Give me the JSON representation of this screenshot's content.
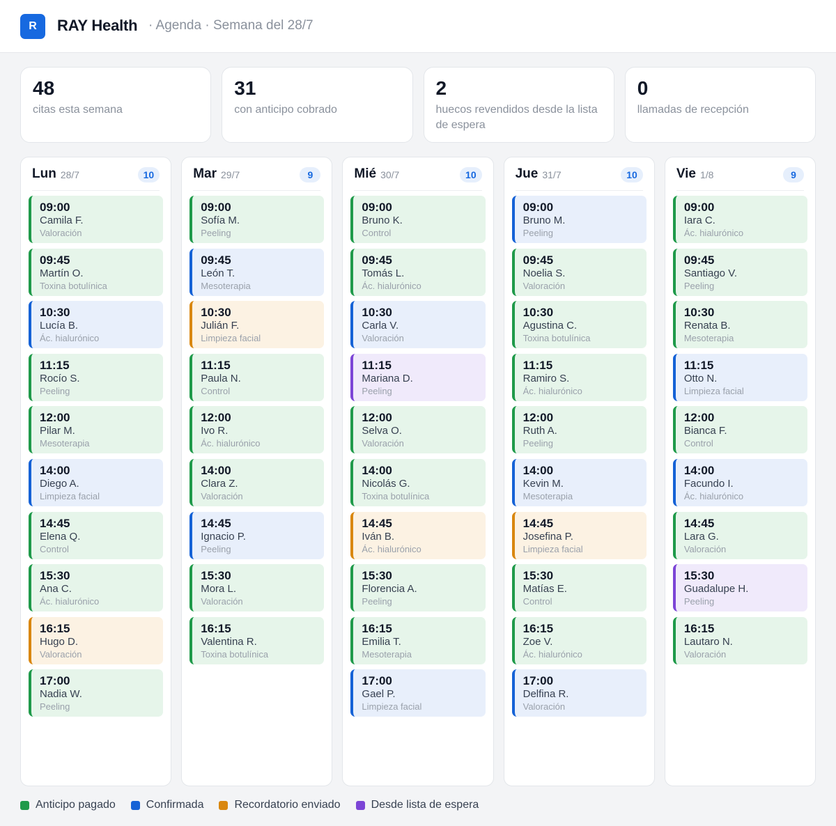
{
  "header": {
    "logo_letter": "R",
    "app_name": "RAY Health",
    "breadcrumb": "· Agenda · Semana del 28/7"
  },
  "stats": [
    {
      "value": "48",
      "label": "citas esta semana"
    },
    {
      "value": "31",
      "label": "con anticipo cobrado"
    },
    {
      "value": "2",
      "label": "huecos revendidos desde la lista de espera"
    },
    {
      "value": "0",
      "label": "llamadas de recepción"
    }
  ],
  "days": [
    {
      "name": "Lun",
      "date": "28/7",
      "count": "10",
      "appointments": [
        {
          "time": "09:00",
          "patient": "Camila F.",
          "service": "Valoración",
          "status": "paid"
        },
        {
          "time": "09:45",
          "patient": "Martín O.",
          "service": "Toxina botulínica",
          "status": "paid"
        },
        {
          "time": "10:30",
          "patient": "Lucía B.",
          "service": "Ác. hialurónico",
          "status": "confirmed"
        },
        {
          "time": "11:15",
          "patient": "Rocío S.",
          "service": "Peeling",
          "status": "paid"
        },
        {
          "time": "12:00",
          "patient": "Pilar M.",
          "service": "Mesoterapia",
          "status": "paid"
        },
        {
          "time": "14:00",
          "patient": "Diego A.",
          "service": "Limpieza facial",
          "status": "confirmed"
        },
        {
          "time": "14:45",
          "patient": "Elena Q.",
          "service": "Control",
          "status": "paid"
        },
        {
          "time": "15:30",
          "patient": "Ana C.",
          "service": "Ác. hialurónico",
          "status": "paid"
        },
        {
          "time": "16:15",
          "patient": "Hugo D.",
          "service": "Valoración",
          "status": "reminder"
        },
        {
          "time": "17:00",
          "patient": "Nadia W.",
          "service": "Peeling",
          "status": "paid"
        }
      ]
    },
    {
      "name": "Mar",
      "date": "29/7",
      "count": "9",
      "appointments": [
        {
          "time": "09:00",
          "patient": "Sofía M.",
          "service": "Peeling",
          "status": "paid"
        },
        {
          "time": "09:45",
          "patient": "León T.",
          "service": "Mesoterapia",
          "status": "confirmed"
        },
        {
          "time": "10:30",
          "patient": "Julián F.",
          "service": "Limpieza facial",
          "status": "reminder"
        },
        {
          "time": "11:15",
          "patient": "Paula N.",
          "service": "Control",
          "status": "paid"
        },
        {
          "time": "12:00",
          "patient": "Ivo R.",
          "service": "Ác. hialurónico",
          "status": "paid"
        },
        {
          "time": "14:00",
          "patient": "Clara Z.",
          "service": "Valoración",
          "status": "paid"
        },
        {
          "time": "14:45",
          "patient": "Ignacio P.",
          "service": "Peeling",
          "status": "confirmed"
        },
        {
          "time": "15:30",
          "patient": "Mora L.",
          "service": "Valoración",
          "status": "paid"
        },
        {
          "time": "16:15",
          "patient": "Valentina R.",
          "service": "Toxina botulínica",
          "status": "paid"
        }
      ]
    },
    {
      "name": "Mié",
      "date": "30/7",
      "count": "10",
      "appointments": [
        {
          "time": "09:00",
          "patient": "Bruno K.",
          "service": "Control",
          "status": "paid"
        },
        {
          "time": "09:45",
          "patient": "Tomás L.",
          "service": "Ác. hialurónico",
          "status": "paid"
        },
        {
          "time": "10:30",
          "patient": "Carla V.",
          "service": "Valoración",
          "status": "confirmed"
        },
        {
          "time": "11:15",
          "patient": "Mariana D.",
          "service": "Peeling",
          "status": "waitlist"
        },
        {
          "time": "12:00",
          "patient": "Selva O.",
          "service": "Valoración",
          "status": "paid"
        },
        {
          "time": "14:00",
          "patient": "Nicolás G.",
          "service": "Toxina botulínica",
          "status": "paid"
        },
        {
          "time": "14:45",
          "patient": "Iván B.",
          "service": "Ác. hialurónico",
          "status": "reminder"
        },
        {
          "time": "15:30",
          "patient": "Florencia A.",
          "service": "Peeling",
          "status": "paid"
        },
        {
          "time": "16:15",
          "patient": "Emilia T.",
          "service": "Mesoterapia",
          "status": "paid"
        },
        {
          "time": "17:00",
          "patient": "Gael P.",
          "service": "Limpieza facial",
          "status": "confirmed"
        }
      ]
    },
    {
      "name": "Jue",
      "date": "31/7",
      "count": "10",
      "appointments": [
        {
          "time": "09:00",
          "patient": "Bruno M.",
          "service": "Peeling",
          "status": "confirmed"
        },
        {
          "time": "09:45",
          "patient": "Noelia S.",
          "service": "Valoración",
          "status": "paid"
        },
        {
          "time": "10:30",
          "patient": "Agustina C.",
          "service": "Toxina botulínica",
          "status": "paid"
        },
        {
          "time": "11:15",
          "patient": "Ramiro S.",
          "service": "Ác. hialurónico",
          "status": "paid"
        },
        {
          "time": "12:00",
          "patient": "Ruth A.",
          "service": "Peeling",
          "status": "paid"
        },
        {
          "time": "14:00",
          "patient": "Kevin M.",
          "service": "Mesoterapia",
          "status": "confirmed"
        },
        {
          "time": "14:45",
          "patient": "Josefina P.",
          "service": "Limpieza facial",
          "status": "reminder"
        },
        {
          "time": "15:30",
          "patient": "Matías E.",
          "service": "Control",
          "status": "paid"
        },
        {
          "time": "16:15",
          "patient": "Zoe V.",
          "service": "Ác. hialurónico",
          "status": "paid"
        },
        {
          "time": "17:00",
          "patient": "Delfina R.",
          "service": "Valoración",
          "status": "confirmed"
        }
      ]
    },
    {
      "name": "Vie",
      "date": "1/8",
      "count": "9",
      "appointments": [
        {
          "time": "09:00",
          "patient": "Iara C.",
          "service": "Ác. hialurónico",
          "status": "paid"
        },
        {
          "time": "09:45",
          "patient": "Santiago V.",
          "service": "Peeling",
          "status": "paid"
        },
        {
          "time": "10:30",
          "patient": "Renata B.",
          "service": "Mesoterapia",
          "status": "paid"
        },
        {
          "time": "11:15",
          "patient": "Otto N.",
          "service": "Limpieza facial",
          "status": "confirmed"
        },
        {
          "time": "12:00",
          "patient": "Bianca F.",
          "service": "Control",
          "status": "paid"
        },
        {
          "time": "14:00",
          "patient": "Facundo I.",
          "service": "Ác. hialurónico",
          "status": "confirmed"
        },
        {
          "time": "14:45",
          "patient": "Lara G.",
          "service": "Valoración",
          "status": "paid"
        },
        {
          "time": "15:30",
          "patient": "Guadalupe H.",
          "service": "Peeling",
          "status": "waitlist"
        },
        {
          "time": "16:15",
          "patient": "Lautaro N.",
          "service": "Valoración",
          "status": "paid"
        }
      ]
    }
  ],
  "legend": [
    {
      "key": "paid",
      "label": "Anticipo pagado",
      "color": "#1f9a4a"
    },
    {
      "key": "confirmed",
      "label": "Confirmada",
      "color": "#1562d6"
    },
    {
      "key": "reminder",
      "label": "Recordatorio enviado",
      "color": "#d9870f"
    },
    {
      "key": "waitlist",
      "label": "Desde lista de espera",
      "color": "#7c45d6"
    }
  ],
  "colors": {
    "brand": "#1769e0",
    "paid": "#1f9a4a",
    "confirmed": "#1562d6",
    "reminder": "#d9870f",
    "waitlist": "#7c45d6"
  }
}
